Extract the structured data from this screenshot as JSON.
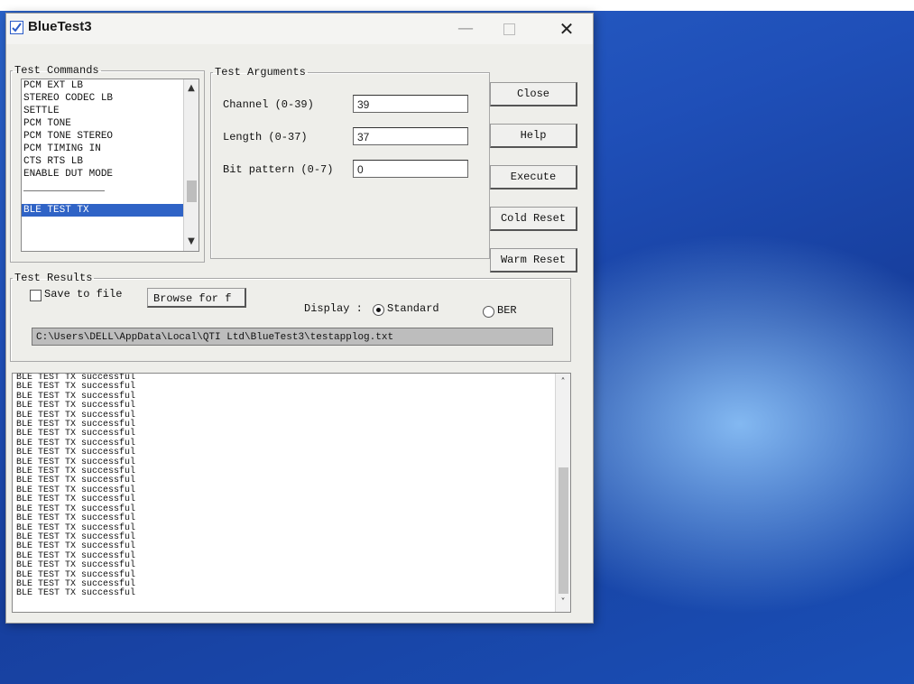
{
  "window": {
    "title": "BlueTest3"
  },
  "test_commands": {
    "legend": "Test Commands",
    "items": [
      "PCM EXT LB",
      "STEREO CODEC LB",
      "SETTLE",
      "PCM TONE",
      "PCM TONE STEREO",
      "PCM TIMING IN",
      "CTS RTS LB",
      "ENABLE DUT MODE",
      "BLE TEST TX"
    ],
    "selected": "BLE TEST TX"
  },
  "test_arguments": {
    "legend": "Test Arguments",
    "channel": {
      "label": "Channel (0-39)",
      "value": "39"
    },
    "length": {
      "label": "Length (0-37)",
      "value": "37"
    },
    "bit_pattern": {
      "label": "Bit pattern (0-7)",
      "value": "0"
    }
  },
  "buttons": {
    "close": "Close",
    "help": "Help",
    "execute": "Execute",
    "cold_reset": "Cold Reset",
    "warm_reset": "Warm Reset"
  },
  "test_results": {
    "legend": "Test Results",
    "save_to_file": "Save to file",
    "save_checked": false,
    "browse": "Browse for f",
    "display_label": "Display :",
    "display_options": [
      "Standard",
      "BER"
    ],
    "display_selected": "Standard",
    "log_path": "C:\\Users\\DELL\\AppData\\Local\\QTI Ltd\\BlueTest3\\testapplog.txt"
  },
  "log": {
    "lines": [
      "BLE TEST TX successful",
      "BLE TEST TX successful",
      "BLE TEST TX successful",
      "BLE TEST TX successful",
      "BLE TEST TX successful",
      "BLE TEST TX successful",
      "BLE TEST TX successful",
      "BLE TEST TX successful",
      "BLE TEST TX successful",
      "BLE TEST TX successful",
      "BLE TEST TX successful",
      "BLE TEST TX successful",
      "BLE TEST TX successful",
      "BLE TEST TX successful",
      "BLE TEST TX successful",
      "BLE TEST TX successful",
      "BLE TEST TX successful",
      "BLE TEST TX successful",
      "BLE TEST TX successful",
      "BLE TEST TX successful",
      "BLE TEST TX successful",
      "BLE TEST TX successful",
      "BLE TEST TX successful",
      "BLE TEST TX successful"
    ]
  },
  "colors": {
    "selection": "#2f63c6",
    "desktop": "#1f4fb8",
    "window_bg": "#eeeeea"
  }
}
